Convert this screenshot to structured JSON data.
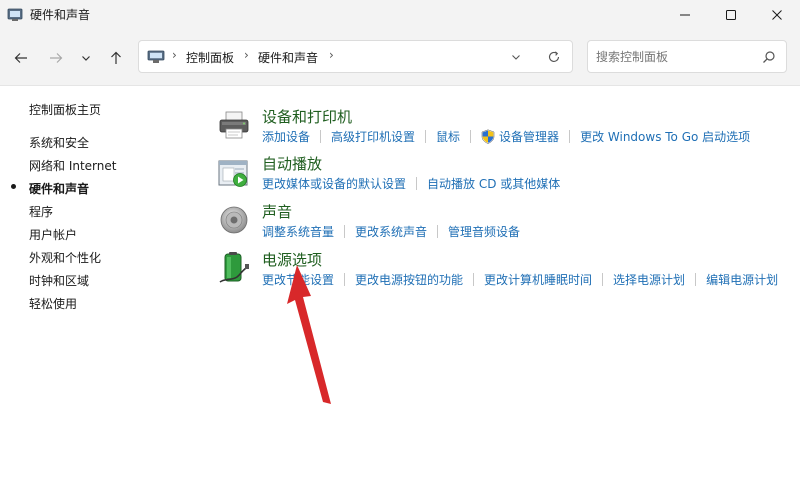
{
  "window": {
    "title": "硬件和声音"
  },
  "navigation": {
    "breadcrumb": [
      "控制面板",
      "硬件和声音"
    ]
  },
  "search": {
    "placeholder": "搜索控制面板"
  },
  "sidebar": {
    "items": [
      {
        "label": "控制面板主页",
        "current": false
      },
      {
        "label": "系统和安全",
        "current": false
      },
      {
        "label": "网络和 Internet",
        "current": false
      },
      {
        "label": "硬件和声音",
        "current": true
      },
      {
        "label": "程序",
        "current": false
      },
      {
        "label": "用户帐户",
        "current": false
      },
      {
        "label": "外观和个性化",
        "current": false
      },
      {
        "label": "时钟和区域",
        "current": false
      },
      {
        "label": "轻松使用",
        "current": false
      }
    ]
  },
  "categories": [
    {
      "title": "设备和打印机",
      "icon": "printer-icon",
      "links": [
        "添加设备",
        "高级打印机设置",
        "鼠标",
        "设备管理器",
        "更改 Windows To Go 启动选项"
      ]
    },
    {
      "title": "自动播放",
      "icon": "autoplay-icon",
      "links": [
        "更改媒体或设备的默认设置",
        "自动播放 CD 或其他媒体"
      ]
    },
    {
      "title": "声音",
      "icon": "speaker-icon",
      "links": [
        "调整系统音量",
        "更改系统声音",
        "管理音频设备"
      ]
    },
    {
      "title": "电源选项",
      "icon": "battery-icon",
      "links": [
        "更改节能设置",
        "更改电源按钮的功能",
        "更改计算机睡眠时间",
        "选择电源计划",
        "编辑电源计划"
      ]
    }
  ],
  "colors": {
    "category_title": "#1f5e1f",
    "link": "#1f6fb5",
    "annotation_arrow": "#d8282a",
    "chrome_background": "#f3f3f3"
  }
}
